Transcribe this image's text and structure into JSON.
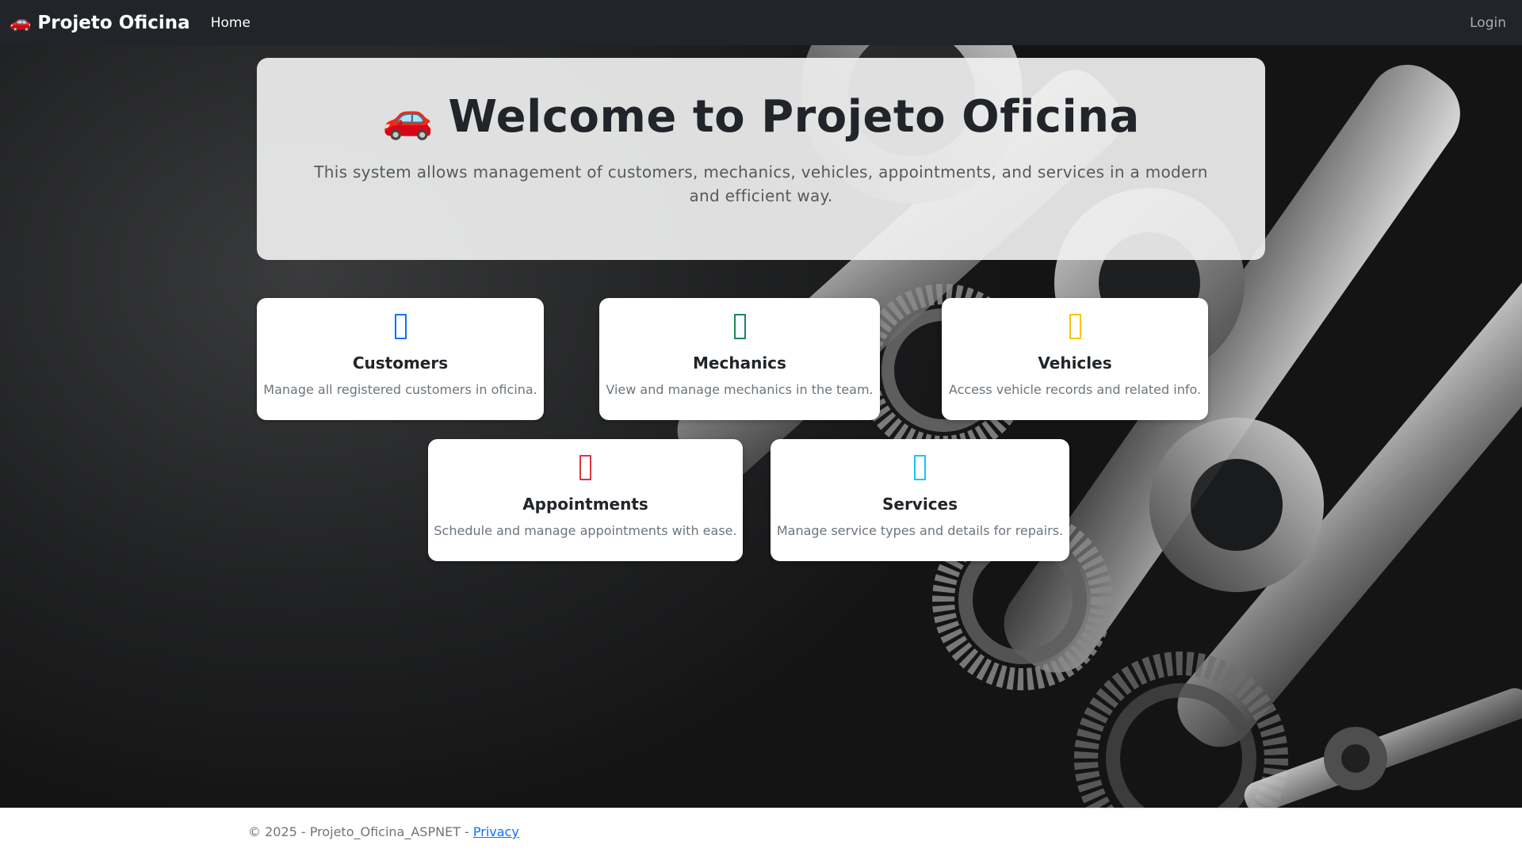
{
  "navbar": {
    "brand_icon": "🚗",
    "brand_text": "Projeto Oficina",
    "home_label": "Home",
    "login_label": "Login"
  },
  "welcome": {
    "icon": "🚗",
    "title": "Welcome to Projeto Oficina",
    "subtitle": "This system allows management of customers, mechanics, vehicles, appointments, and services in a modern and efficient way."
  },
  "cards": [
    {
      "icon": "people-icon",
      "color": "#0d6efd",
      "title": "Customers",
      "description": "Manage all registered customers in oficina."
    },
    {
      "icon": "wrench-icon",
      "color": "#198754",
      "title": "Mechanics",
      "description": "View and manage mechanics in the team."
    },
    {
      "icon": "car-icon",
      "color": "#ffc107",
      "title": "Vehicles",
      "description": "Access vehicle records and related info."
    },
    {
      "icon": "calendar-icon",
      "color": "#dc3545",
      "title": "Appointments",
      "description": "Schedule and manage appointments with ease."
    },
    {
      "icon": "tools-icon",
      "color": "#0dcaf0",
      "title": "Services",
      "description": "Manage service types and details for repairs."
    }
  ],
  "footer": {
    "copyright": "© 2025 - Projeto_Oficina_ASPNET - ",
    "privacy_label": "Privacy"
  }
}
